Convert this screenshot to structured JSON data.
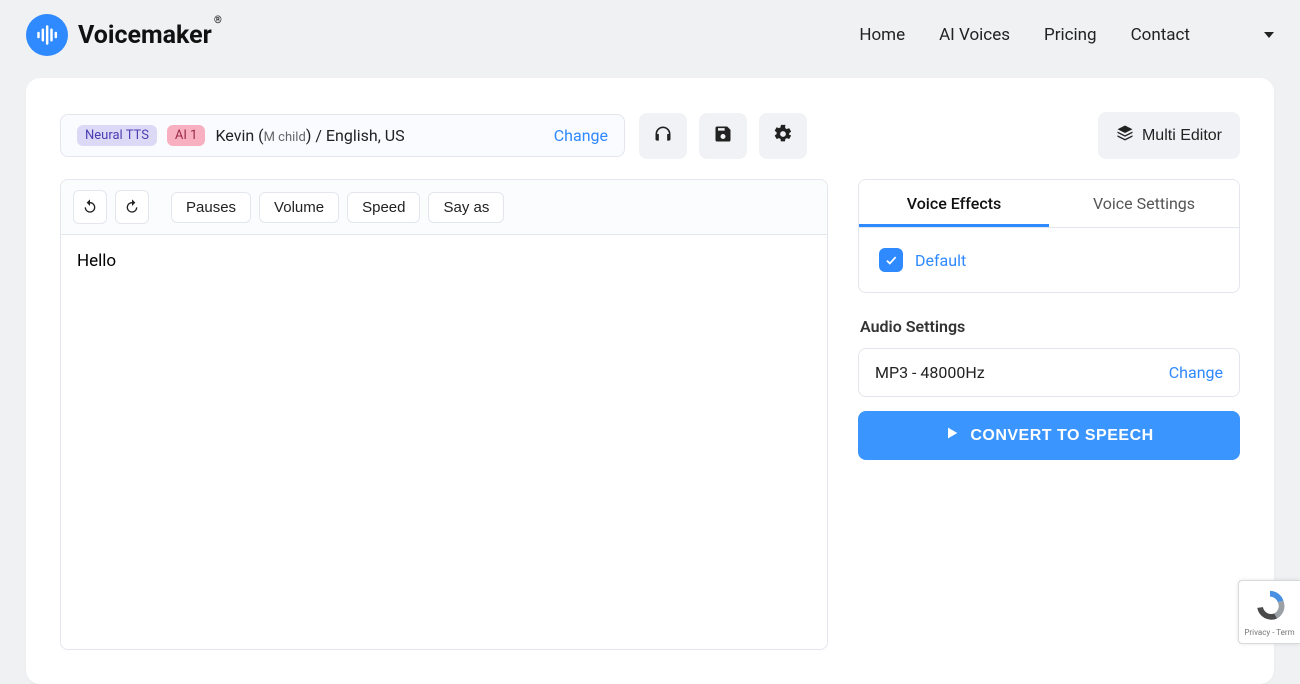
{
  "logo_text": "Voicemaker",
  "nav": {
    "home": "Home",
    "ai_voices": "AI Voices",
    "pricing": "Pricing",
    "contact": "Contact"
  },
  "voice": {
    "badge_engine": "Neural TTS",
    "badge_ai": "AI 1",
    "name_pre": "Kevin (",
    "name_sub": "M child",
    "name_post": ") / ",
    "language": "English, US",
    "change_label": "Change"
  },
  "multi_editor_label": "Multi Editor",
  "toolbar": {
    "pauses": "Pauses",
    "volume": "Volume",
    "speed": "Speed",
    "say_as": "Say as"
  },
  "editor_text": "Hello",
  "side": {
    "tab_effects": "Voice Effects",
    "tab_settings": "Voice Settings",
    "default_label": "Default",
    "audio_section_title": "Audio Settings",
    "audio_format": "MP3 - 48000Hz",
    "audio_change": "Change",
    "convert_label": "CONVERT TO SPEECH"
  },
  "recaptcha_text": "Privacy - Term"
}
